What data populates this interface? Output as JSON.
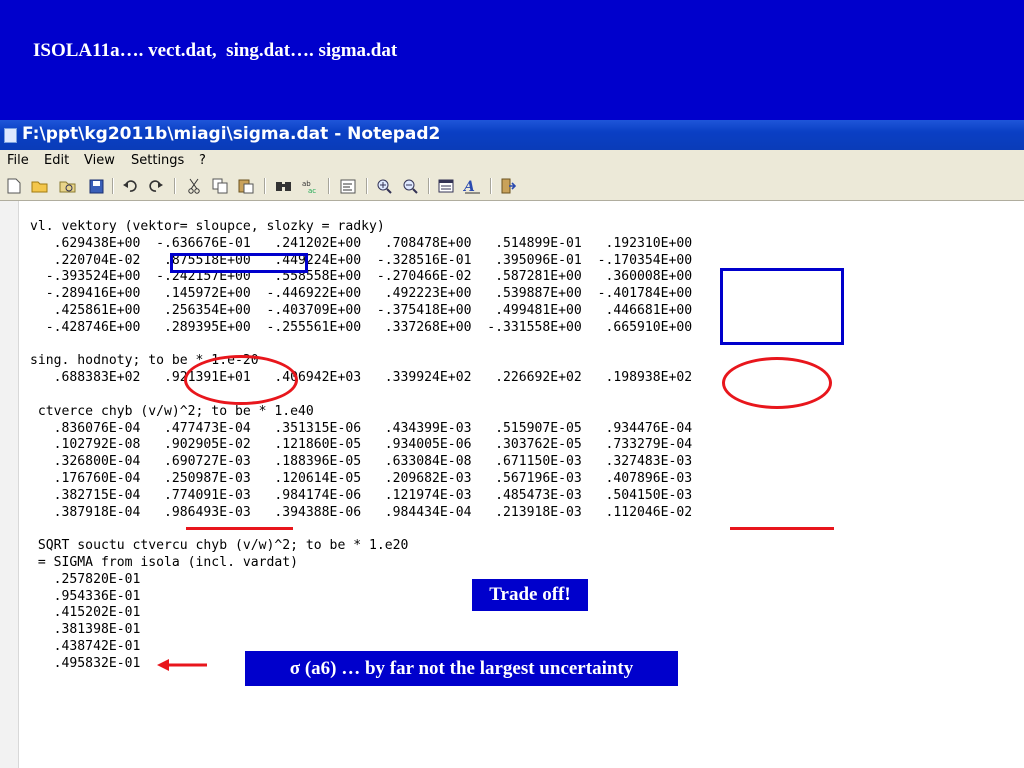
{
  "slide": {
    "title": "ISOLA11a…. vect.dat,  sing.dat…. sigma.dat"
  },
  "window": {
    "title": "F:\\ppt\\kg2011b\\miagi\\sigma.dat - Notepad2",
    "menu": [
      "File",
      "Edit",
      "View",
      "Settings",
      "?"
    ],
    "toolbar_icons": [
      "new-file-icon",
      "open-folder-icon",
      "browse-icon",
      "save-icon",
      "undo-icon",
      "redo-icon",
      "cut-icon",
      "copy-icon",
      "paste-icon",
      "find-icon",
      "replace-icon",
      "word-wrap-icon",
      "zoom-in-icon",
      "zoom-out-icon",
      "schemes-icon",
      "font-icon",
      "exit-icon"
    ]
  },
  "editor": {
    "lines": [
      "vl. vektory (vektor= sloupce, slozky = radky)",
      "   .629438E+00  -.636676E-01   .241202E+00   .708478E+00   .514899E-01   .192310E+00",
      "   .220704E-02   .875518E+00   .449224E+00  -.328516E-01   .395096E-01  -.170354E+00",
      "  -.393524E+00  -.242157E+00   .558558E+00  -.270466E-02   .587281E+00   .360008E+00",
      "  -.289416E+00   .145972E+00  -.446922E+00   .492223E+00   .539887E+00  -.401784E+00",
      "   .425861E+00   .256354E+00  -.403709E+00  -.375418E+00   .499481E+00   .446681E+00",
      "  -.428746E+00   .289395E+00  -.255561E+00   .337268E+00  -.331558E+00   .665910E+00",
      "",
      "sing. hodnoty; to be * 1.e-20",
      "   .688383E+02   .921391E+01   .406942E+03   .339924E+02   .226692E+02   .198938E+02",
      "",
      " ctverce chyb (v/w)^2; to be * 1.e40",
      "   .836076E-04   .477473E-04   .351315E-06   .434399E-03   .515907E-05   .934476E-04",
      "   .102792E-08   .902905E-02   .121860E-05   .934005E-06   .303762E-05   .733279E-04",
      "   .326800E-04   .690727E-03   .188396E-05   .633084E-08   .671150E-03   .327483E-03",
      "   .176760E-04   .250987E-03   .120614E-05   .209682E-03   .567196E-03   .407896E-03",
      "   .382715E-04   .774091E-03   .984174E-06   .121974E-03   .485473E-03   .504150E-03",
      "   .387918E-04   .986493E-03   .394388E-06   .984434E-04   .213918E-03   .112046E-02",
      "",
      " SQRT souctu ctvercu chyb (v/w)^2; to be * 1.e20",
      " = SIGMA from isola (incl. vardat)",
      "   .257820E-01",
      "   .954336E-01",
      "   .415202E-01",
      "   .381398E-01",
      "   .438742E-01",
      "   .495832E-01"
    ]
  },
  "annotations": {
    "trade_off": "Trade off!",
    "sigma_note": "σ (a6) … by far not the largest uncertainty",
    "accent_color": "#e8161c",
    "box_color": "#0000cc"
  }
}
